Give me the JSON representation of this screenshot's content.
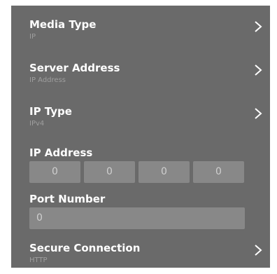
{
  "settings": {
    "media_type": {
      "title": "Media Type",
      "value": "IP"
    },
    "server_address": {
      "title": "Server Address",
      "value": "IP Address"
    },
    "ip_type": {
      "title": "IP Type",
      "value": "IPv4"
    },
    "ip_address": {
      "title": "IP Address",
      "octets": [
        "0",
        "0",
        "0",
        "0"
      ]
    },
    "port_number": {
      "title": "Port Number",
      "value": "0"
    },
    "secure_connection": {
      "title": "Secure Connection",
      "value": "HTTP"
    }
  },
  "icons": {
    "row_arrow": "chevron-right-icon"
  },
  "colors": {
    "panel_background": "#6a6a6a",
    "field_background": "#888888",
    "title_text": "#ffffff",
    "value_text": "#9e9e9e",
    "field_text": "#cfcfcf"
  }
}
